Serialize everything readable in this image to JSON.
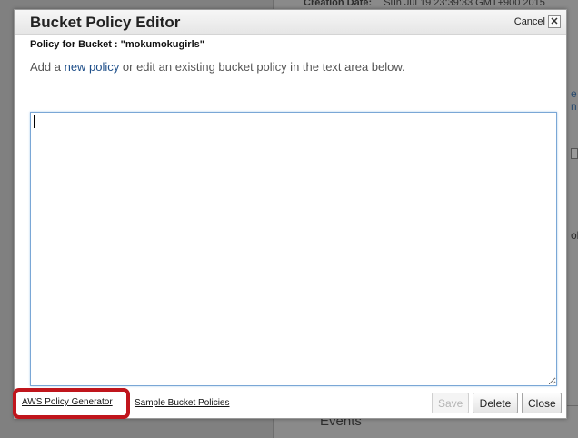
{
  "background": {
    "header_label": "Creation Date:",
    "header_value": "Sun Jul 19 23:39:33 GMT+900 2015",
    "events_label": "Events"
  },
  "dialog": {
    "title": "Bucket Policy Editor",
    "cancel_label": "Cancel",
    "close_glyph": "✕",
    "policy_heading": "Policy for Bucket : \"mokumokugirls\"",
    "instructions": {
      "before": "Add a ",
      "link": "new policy",
      "after": " or edit an existing bucket policy in the text area below."
    },
    "policy_text": ""
  },
  "footer": {
    "policy_generator_link": "AWS Policy Generator",
    "sample_policies_link": "Sample Bucket Policies",
    "save_label": "Save",
    "delete_label": "Delete",
    "close_label": "Close"
  },
  "colors": {
    "highlight": "#c0151c",
    "link": "#1d4e89",
    "textarea_focus": "#7aa7d6"
  },
  "icons": {
    "close": "close-icon"
  }
}
